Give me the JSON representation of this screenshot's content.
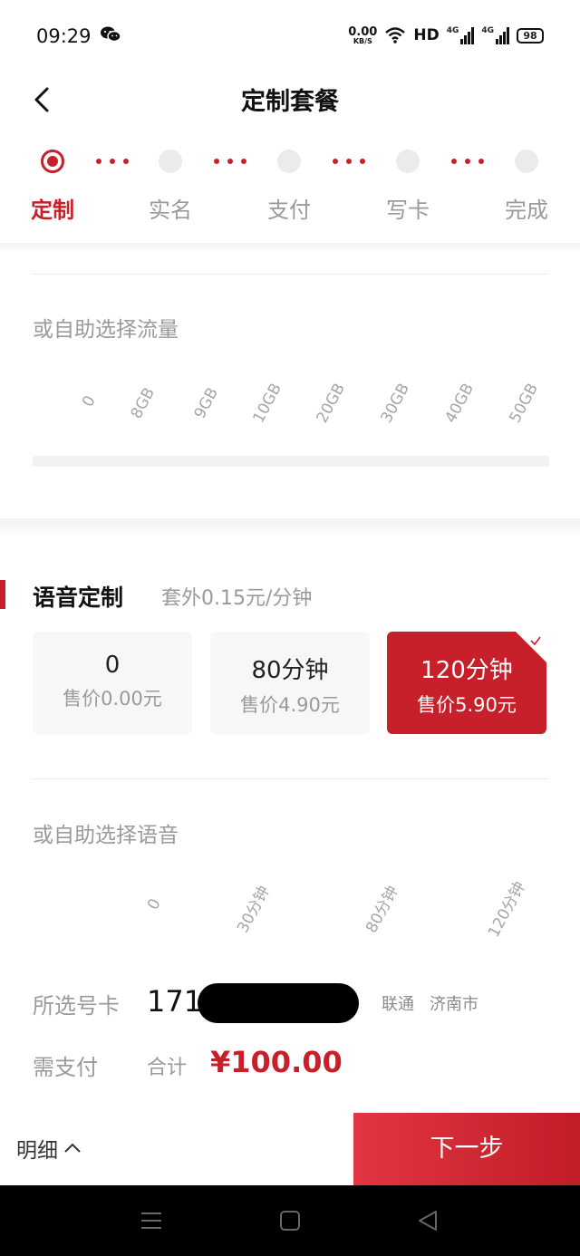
{
  "status_bar": {
    "time": "09:29",
    "net_speed_value": "0.00",
    "net_speed_unit": "KB/S",
    "hd_label": "HD",
    "signal_1_label": "4G",
    "signal_2_label": "4G",
    "battery": "98"
  },
  "header": {
    "title": "定制套餐"
  },
  "steps": [
    "定制",
    "实名",
    "支付",
    "写卡",
    "完成"
  ],
  "data_section": {
    "helper_label": "或自助选择流量",
    "ticks": [
      "0",
      "8GB",
      "9GB",
      "10GB",
      "20GB",
      "30GB",
      "40GB",
      "50GB"
    ]
  },
  "voice_section": {
    "title": "语音定制",
    "subtitle": "套外0.15元/分钟",
    "options": [
      {
        "name": "0",
        "price": "售价0.00元"
      },
      {
        "name": "80分钟",
        "price": "售价4.90元"
      },
      {
        "name": "120分钟",
        "price": "售价5.90元"
      }
    ],
    "helper_label": "或自助选择语音",
    "ticks": [
      "0",
      "30分钟",
      "80分钟",
      "120分钟"
    ]
  },
  "summary": {
    "phone_label": "所选号卡",
    "phone_prefix": "171",
    "carrier": "联通",
    "city": "济南市",
    "pay_label": "需支付",
    "total_label": "合计",
    "amount": "¥100.00"
  },
  "bottom": {
    "detail_label": "明细",
    "next_label": "下一步"
  },
  "colors": {
    "accent": "#c8202a"
  }
}
